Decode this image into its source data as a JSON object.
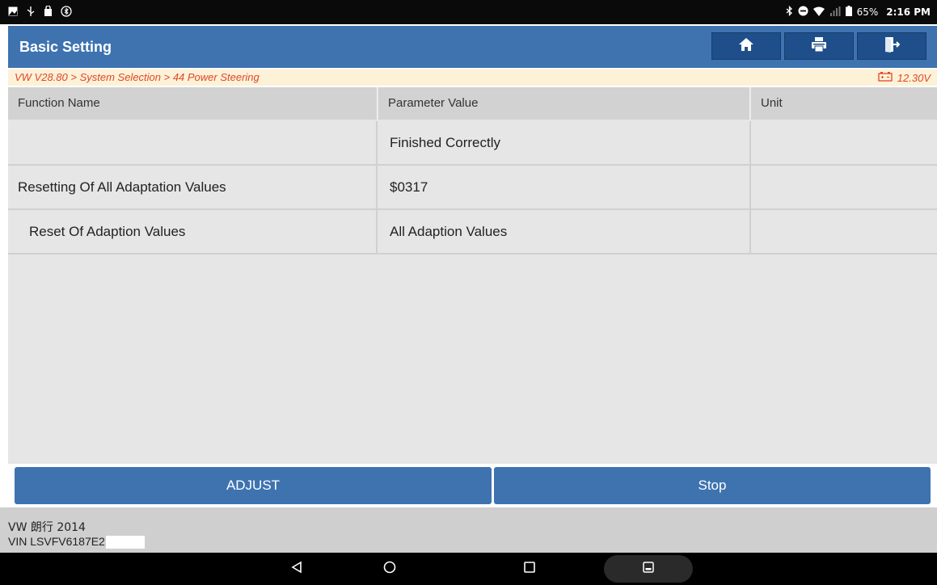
{
  "status_bar": {
    "left_icons": [
      "image-icon",
      "usb-icon",
      "lock-icon",
      "bluetooth-circle-icon"
    ],
    "right_icons": [
      "bluetooth-icon",
      "dnd-icon",
      "wifi-icon",
      "signal-icon",
      "battery-icon"
    ],
    "battery": "65%",
    "time": "2:16 PM"
  },
  "header": {
    "title": "Basic Setting",
    "buttons": [
      "home-icon",
      "print-icon",
      "exit-icon"
    ],
    "accent": "#3e73b0"
  },
  "breadcrumb": {
    "path": "VW V28.80 > System Selection > 44 Power Steering",
    "voltage": "12.30V",
    "color": "#e0462a"
  },
  "table": {
    "columns": [
      "Function Name",
      "Parameter Value",
      "Unit"
    ],
    "rows": [
      {
        "name": "",
        "value": "Finished Correctly",
        "unit": ""
      },
      {
        "name": "Resetting Of All Adaptation Values",
        "value": "$0317",
        "unit": ""
      },
      {
        "name": "Reset Of Adaption Values",
        "value": "All Adaption Values",
        "unit": ""
      }
    ]
  },
  "actions": {
    "adjust": "ADJUST",
    "stop": "Stop"
  },
  "footer": {
    "model": "VW 朗行 2014",
    "vin": "VIN LSVFV6187E2"
  },
  "nav_bar": [
    "back-icon",
    "home-circle-icon",
    "recents-icon",
    "screenshot-icon"
  ]
}
